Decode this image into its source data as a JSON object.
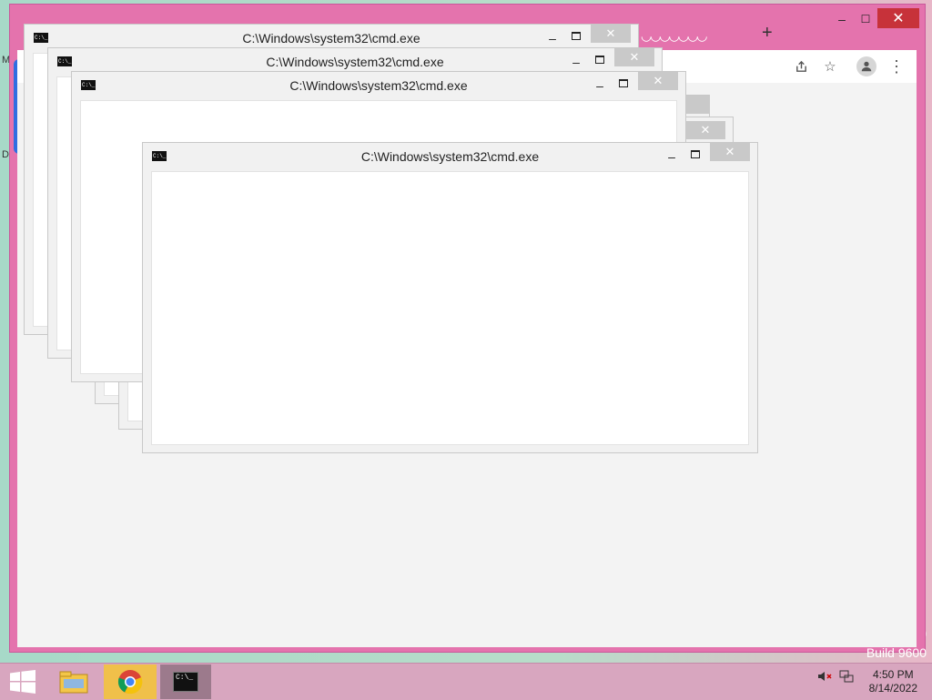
{
  "desktop": {
    "left_label_1": "M",
    "left_label_2": "D",
    "build_label": "Build 9600",
    "build_frag": "0"
  },
  "chrome": {
    "minimize_glyph": "–",
    "maximize_glyph": "☐",
    "close_glyph": "✕",
    "newtab_glyph": "+",
    "share_icon": "share-icon",
    "bookmark_icon": "star-icon",
    "profile_icon": "profile-icon",
    "menu_icon": "more-vert-icon"
  },
  "cmd_windows": [
    {
      "title": "C:\\Windows\\system32\\cmd.exe",
      "icon_text": "C:\\_"
    },
    {
      "title": "C:\\Windows\\system32\\cmd.exe",
      "icon_text": "C:\\_"
    },
    {
      "title": "C:\\Windows\\system32\\cmd.exe",
      "icon_text": "C:\\_"
    },
    {
      "title": "C:\\Windows\\system32\\cmd.exe",
      "icon_text": "C:\\_"
    }
  ],
  "cmd_buttons": {
    "minimize": "–",
    "close": "✕"
  },
  "taskbar": {
    "start_icon": "windows-start-icon",
    "apps": [
      "file-explorer",
      "google-chrome",
      "command-prompt"
    ],
    "clock_time": "4:50 PM",
    "clock_date": "8/14/2022",
    "tray_icons": [
      "volume-muted-icon",
      "network-icon"
    ]
  },
  "colors": {
    "chrome_frame": "#e473ad",
    "taskbar": "#d8a6bf",
    "close_red": "#c7323a"
  }
}
